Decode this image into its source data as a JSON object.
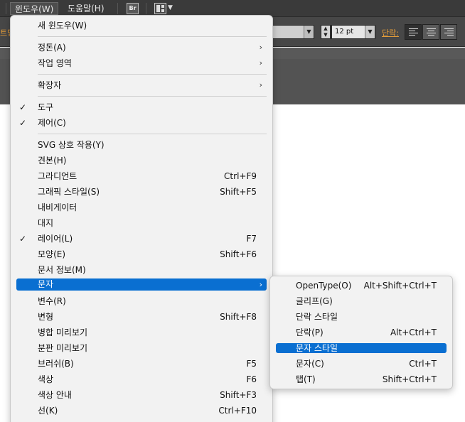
{
  "menubar": {
    "items": [
      "윈도우(W)",
      "도움말(H)"
    ],
    "bridge_badge": "Br",
    "control_left_label": "트명",
    "font_size_value": "12 pt",
    "paragraph_label": "단락:",
    "colors": {
      "chrome": "#3a3a3a",
      "accent_label": "#e39c3a",
      "highlight": "#0a6fd1"
    }
  },
  "main_menu": {
    "items": [
      {
        "label": "새 윈도우(W)"
      },
      {
        "label": "정돈(A)",
        "submenu": true
      },
      {
        "label": "작업 영역",
        "submenu": true
      },
      {
        "label": "확장자",
        "submenu": true
      },
      {
        "label": "도구",
        "checked": true
      },
      {
        "label": "제어(C)",
        "checked": true
      },
      {
        "label": "SVG 상호 작용(Y)"
      },
      {
        "label": "견본(H)"
      },
      {
        "label": "그라디언트",
        "shortcut": "Ctrl+F9"
      },
      {
        "label": "그래픽 스타일(S)",
        "shortcut": "Shift+F5"
      },
      {
        "label": "내비게이터"
      },
      {
        "label": "대지"
      },
      {
        "label": "레이어(L)",
        "shortcut": "F7",
        "checked": true
      },
      {
        "label": "모양(E)",
        "shortcut": "Shift+F6"
      },
      {
        "label": "문서 정보(M)"
      },
      {
        "label": "문자",
        "submenu": true,
        "highlighted": true
      },
      {
        "label": "변수(R)"
      },
      {
        "label": "변형",
        "shortcut": "Shift+F8"
      },
      {
        "label": "병합 미리보기"
      },
      {
        "label": "분판 미리보기"
      },
      {
        "label": "브러쉬(B)",
        "shortcut": "F5"
      },
      {
        "label": "색상",
        "shortcut": "F6"
      },
      {
        "label": "색상 안내",
        "shortcut": "Shift+F3"
      },
      {
        "label": "선(K)",
        "shortcut": "Ctrl+F10"
      }
    ],
    "check_glyph": "✓",
    "arrow_glyph": "›"
  },
  "sub_menu": {
    "items": [
      {
        "label": "OpenType(O)",
        "shortcut": "Alt+Shift+Ctrl+T"
      },
      {
        "label": "글리프(G)"
      },
      {
        "label": "단락 스타일"
      },
      {
        "label": "단락(P)",
        "shortcut": "Alt+Ctrl+T"
      },
      {
        "label": "문자 스타일",
        "highlighted": true
      },
      {
        "label": "문자(C)",
        "shortcut": "Ctrl+T"
      },
      {
        "label": "탭(T)",
        "shortcut": "Shift+Ctrl+T"
      }
    ]
  }
}
